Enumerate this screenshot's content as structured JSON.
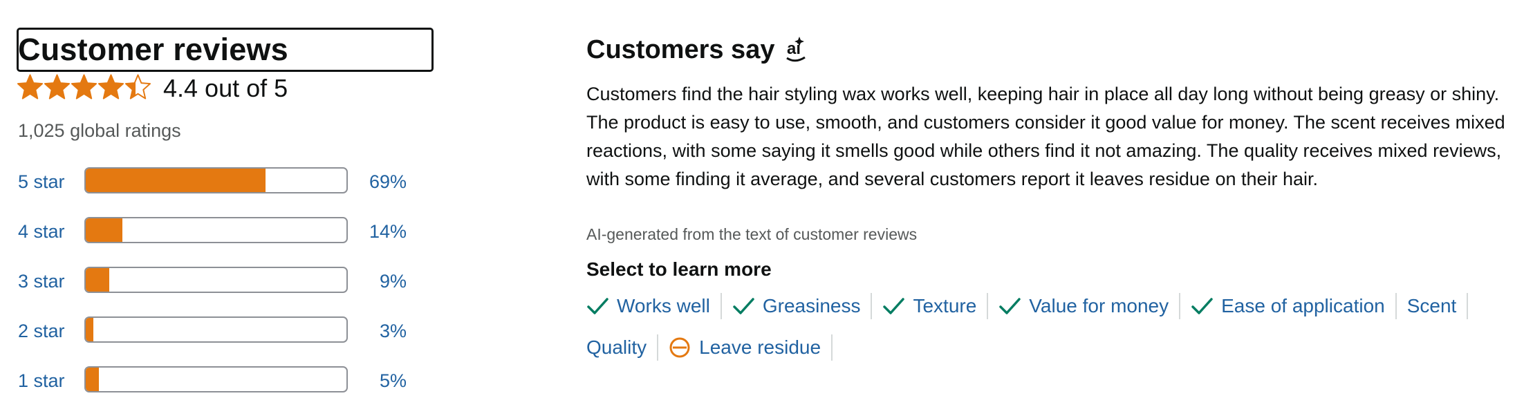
{
  "reviews": {
    "title": "Customer reviews",
    "rating_value": 4.4,
    "rating_text": "4.4 out of 5",
    "stars_filled_fraction": [
      1,
      1,
      1,
      1,
      0.4
    ],
    "global_ratings": "1,025 global ratings",
    "histogram": [
      {
        "label": "5 star",
        "percent_text": "69%",
        "percent": 69
      },
      {
        "label": "4 star",
        "percent_text": "14%",
        "percent": 14
      },
      {
        "label": "3 star",
        "percent_text": "9%",
        "percent": 9
      },
      {
        "label": "2 star",
        "percent_text": "3%",
        "percent": 3
      },
      {
        "label": "1 star",
        "percent_text": "5%",
        "percent": 5
      }
    ]
  },
  "customers_say": {
    "title": "Customers say",
    "ai_icon": "ai-icon",
    "summary": "Customers find the hair styling wax works well, keeping hair in place all day long without being greasy or shiny. The product is easy to use, smooth, and customers consider it good value for money. The scent receives mixed reactions, with some saying it smells good while others find it not amazing. The quality receives mixed reviews, with some finding it average, and several customers report it leaves residue on their hair.",
    "ai_note": "AI-generated from the text of customer reviews",
    "select_label": "Select to learn more",
    "aspects": [
      {
        "label": "Works well",
        "sentiment": "positive",
        "icon": "check-icon"
      },
      {
        "label": "Greasiness",
        "sentiment": "positive",
        "icon": "check-icon"
      },
      {
        "label": "Texture",
        "sentiment": "positive",
        "icon": "check-icon"
      },
      {
        "label": "Value for money",
        "sentiment": "positive",
        "icon": "check-icon"
      },
      {
        "label": "Ease of application",
        "sentiment": "positive",
        "icon": "check-icon"
      },
      {
        "label": "Scent",
        "sentiment": "mixed",
        "icon": ""
      },
      {
        "label": "Quality",
        "sentiment": "mixed",
        "icon": ""
      },
      {
        "label": "Leave residue",
        "sentiment": "negative",
        "icon": "minus-circle-icon"
      }
    ]
  },
  "colors": {
    "star": "#e47911",
    "bar_fill": "#e47911",
    "link": "#2162a1",
    "positive": "#067d62",
    "negative": "#e47911"
  }
}
